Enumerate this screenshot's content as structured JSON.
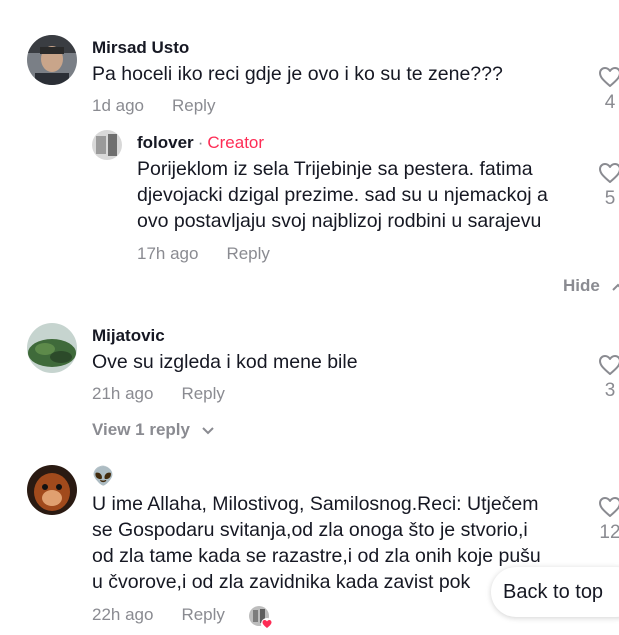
{
  "comments": [
    {
      "username": "Mirsad Usto",
      "text": "Pa hoceli iko reci gdje je ovo i ko su te zene???",
      "time": "1d ago",
      "reply_label": "Reply",
      "likes": "4"
    },
    {
      "username": "folover",
      "separator": "·",
      "badge": "Creator",
      "text": "Porijeklom iz sela Trijebinje sa pestera. fatima\ndjevojacki dzigal prezime. sad su u njemackoj a\novo postavljaju svoj najblizoj rodbini u sarajevu",
      "time": "17h ago",
      "reply_label": "Reply",
      "likes": "5"
    },
    {
      "username": "Mijatovic",
      "text": "Ove su izgleda i kod mene bile",
      "time": "21h ago",
      "reply_label": "Reply",
      "likes": "3",
      "view_replies": "View 1 reply"
    },
    {
      "username": "👽",
      "text": "U ime Allaha, Milostivog, Samilosnog.Reci: Utječem\nse Gospodaru svitanja,od zla onoga što je stvorio,i\nod zla tame kada se razastre,i od zla onih koje pušu\nu čvorove,i od zla zavidnika kada zavist pok",
      "time": "22h ago",
      "reply_label": "Reply",
      "likes": "12"
    }
  ],
  "hide_label": "Hide",
  "back_to_top": "Back to top",
  "colors": {
    "text": "#161823",
    "muted": "#8a8b91",
    "creator": "#fe2c55"
  },
  "icons": [
    "heart-icon",
    "chevron-down-icon",
    "chevron-up-icon"
  ]
}
